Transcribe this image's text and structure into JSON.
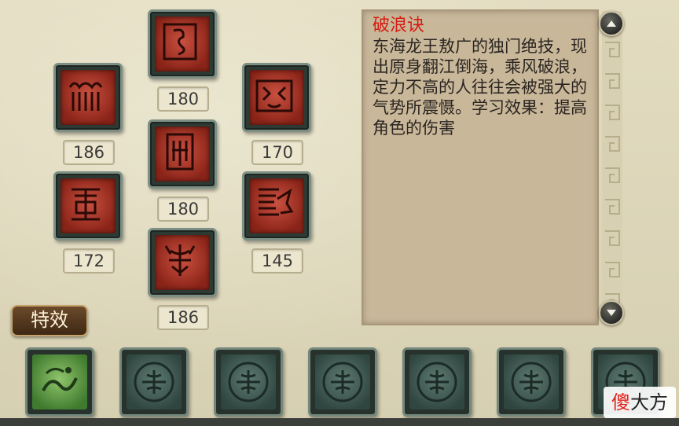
{
  "skills": [
    {
      "id": "top-center",
      "level": "180",
      "icon": "seal-glyph-1"
    },
    {
      "id": "left-1",
      "level": "186",
      "icon": "seal-glyph-2"
    },
    {
      "id": "center-2",
      "level": "180",
      "icon": "seal-glyph-3"
    },
    {
      "id": "right-1",
      "level": "170",
      "icon": "dragon-mask-icon"
    },
    {
      "id": "left-2",
      "level": "172",
      "icon": "seal-glyph-4"
    },
    {
      "id": "right-2",
      "level": "145",
      "icon": "dragon-head-icon"
    },
    {
      "id": "bottom-center",
      "level": "186",
      "icon": "demon-glyph-icon"
    }
  ],
  "description": {
    "title": "破浪诀",
    "body": "东海龙王敖广的独门绝技，现出原身翻江倒海，乘风破浪，定力不高的人往往会被强大的气势所震慑。学习效果：提高角色的伤害"
  },
  "effects_button": "特效",
  "effect_slots": [
    {
      "state": "active",
      "icon": "wave-dragon-icon"
    },
    {
      "state": "locked",
      "icon": "locked-emblem-icon"
    },
    {
      "state": "locked",
      "icon": "locked-emblem-icon"
    },
    {
      "state": "locked",
      "icon": "locked-emblem-icon"
    },
    {
      "state": "locked",
      "icon": "locked-emblem-icon"
    },
    {
      "state": "locked",
      "icon": "locked-emblem-icon"
    },
    {
      "state": "locked",
      "icon": "locked-emblem-icon"
    }
  ],
  "watermark": {
    "part1": "傻",
    "part2": "大方"
  },
  "colors": {
    "title_red": "#d51c12",
    "skill_red": "#b33a2c",
    "jade": "#5d7a70"
  }
}
